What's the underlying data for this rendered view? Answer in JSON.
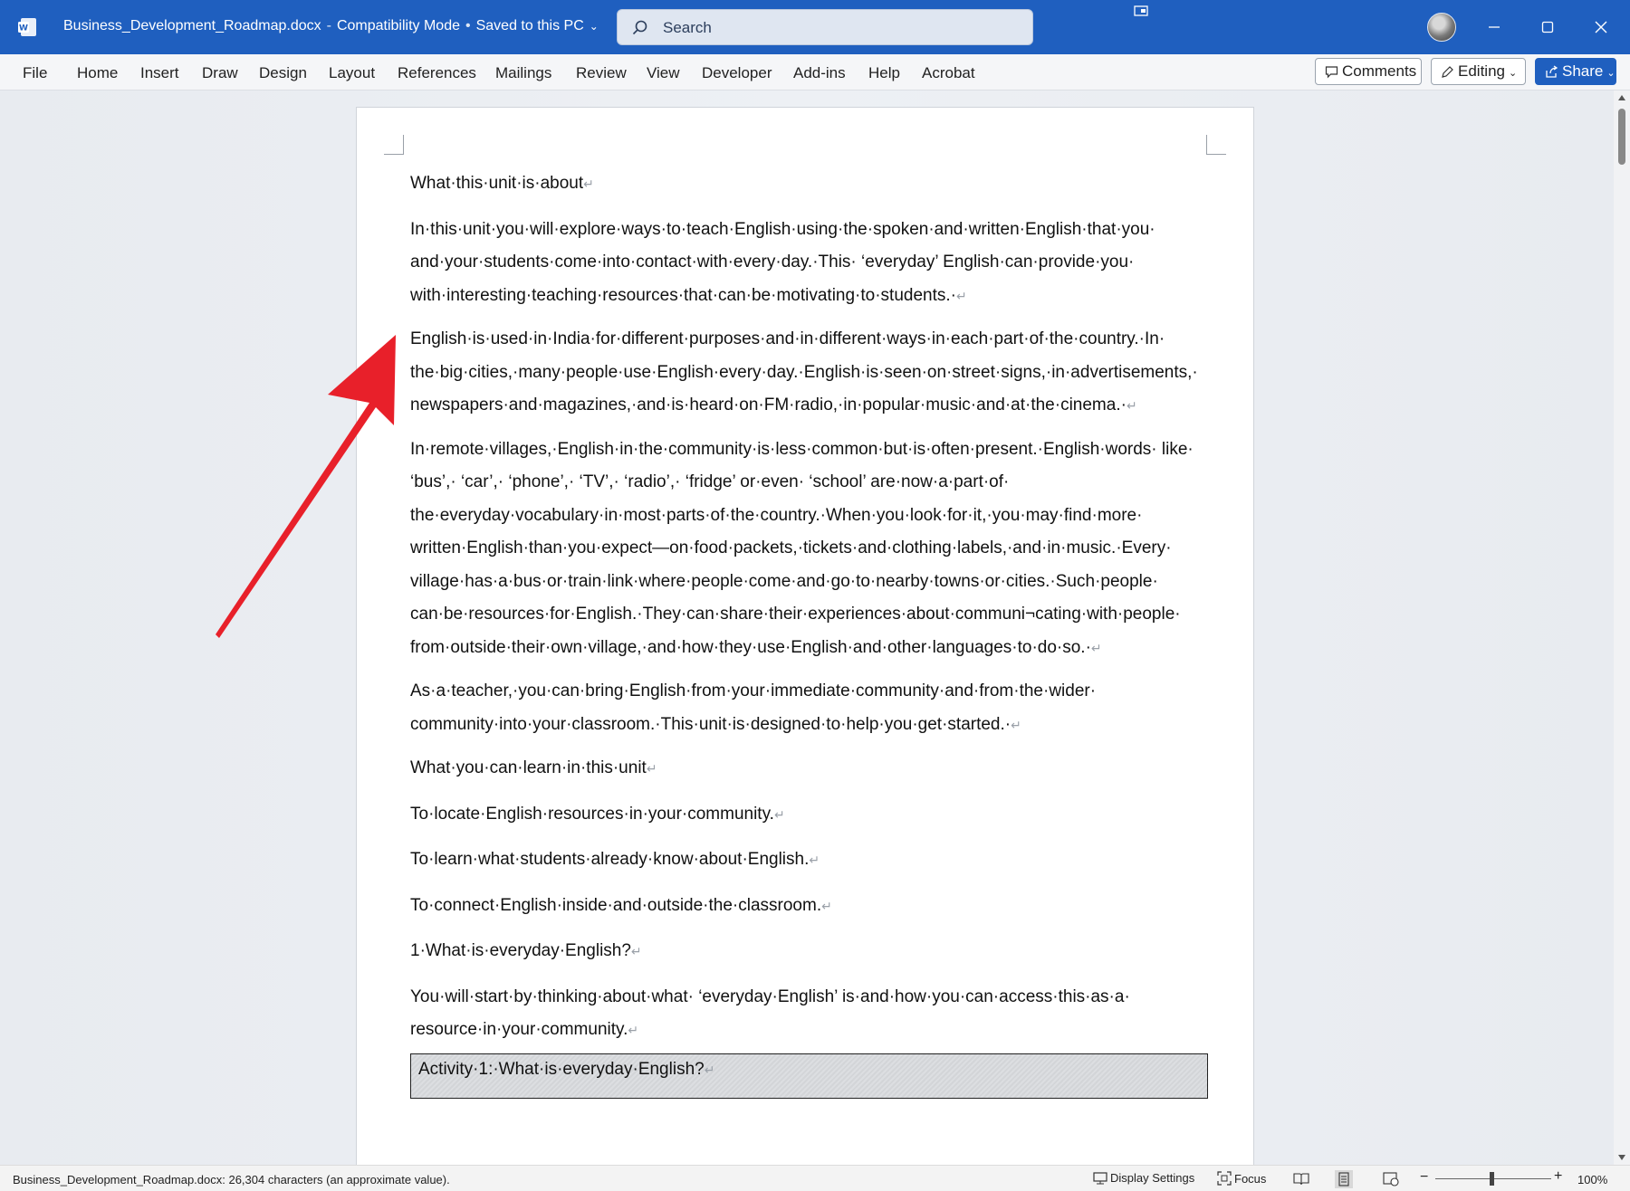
{
  "titlebar": {
    "doc_name": "Business_Development_Roadmap.docx",
    "mode": "Compatibility Mode",
    "saved": "Saved to this PC",
    "search_placeholder": "Search"
  },
  "ribbon": {
    "tabs": [
      "File",
      "Home",
      "Insert",
      "Draw",
      "Design",
      "Layout",
      "References",
      "Mailings",
      "Review",
      "View",
      "Developer",
      "Add-ins",
      "Help",
      "Acrobat"
    ],
    "comments_label": "Comments",
    "editing_label": "Editing",
    "share_label": "Share"
  },
  "document": {
    "paragraphs": [
      "What·this·unit·is·about",
      "In·this·unit·you·will·explore·ways·to·teach·English·using·the·spoken·and·written·English·that·you· and·your·students·come·into·contact·with·every·day.·This· ‘everyday’ English·can·provide·you· with·interesting·teaching·resources·that·can·be·motivating·to·students.·",
      "English·is·used·in·India·for·different·purposes·and·in·different·ways·in·each·part·of·the·country.·In· the·big·cities,·many·people·use·English·every·day.·English·is·seen·on·street·signs,·in·advertisements,· newspapers·and·magazines,·and·is·heard·on·FM·radio,·in·popular·music·and·at·the·cinema.·",
      "In·remote·villages,·English·in·the·community·is·less·common·but·is·often·present.·English·words· like· ‘bus’,· ‘car’,· ‘phone’,· ‘TV’,· ‘radio’,· ‘fridge’ or·even· ‘school’ are·now·a·part·of· the·everyday·vocabulary·in·most·parts·of·the·country.·When·you·look·for·it,·you·may·find·more· written·English·than·you·expect—on·food·packets,·tickets·and·clothing·labels,·and·in·music.·Every· village·has·a·bus·or·train·link·where·people·come·and·go·to·nearby·towns·or·cities.·Such·people· can·be·resources·for·English.·They·can·share·their·experiences·about·communi¬cating·with·people· from·outside·their·own·village,·and·how·they·use·English·and·other·languages·to·do·so.·",
      "As·a·teacher,·you·can·bring·English·from·your·immediate·community·and·from·the·wider· community·into·your·classroom.·This·unit·is·designed·to·help·you·get·started.·",
      "What·you·can·learn·in·this·unit",
      "To·locate·English·resources·in·your·community.",
      "To·learn·what·students·already·know·about·English.",
      "To·connect·English·inside·and·outside·the·classroom.",
      "1·What·is·everyday·English?",
      "You·will·start·by·thinking·about·what· ‘everyday·English’ is·and·how·you·can·access·this·as·a· resource·in·your·community."
    ],
    "activity_title": "Activity·1:·What·is·everyday·English?",
    "para_mark": "↵"
  },
  "statusbar": {
    "info": "Business_Development_Roadmap.docx: 26,304 characters (an approximate value).",
    "display_settings": "Display Settings",
    "focus": "Focus",
    "zoom": "100%"
  },
  "colors": {
    "titlebar": "#1f5fbf",
    "arrow": "#e8202a"
  },
  "icons": [
    "word-app-icon",
    "search-icon",
    "minimize-icon",
    "maximize-icon",
    "close-icon",
    "comment-icon",
    "pencil-icon",
    "share-icon",
    "red-arrow-annotation"
  ]
}
